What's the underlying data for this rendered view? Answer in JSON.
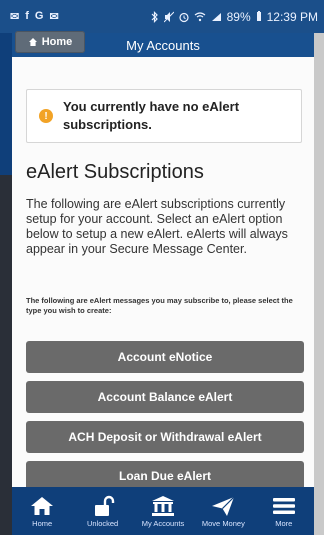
{
  "status_bar": {
    "left_icons": [
      "✉",
      "f",
      "G",
      "✉"
    ],
    "battery": "89%",
    "time": "12:39 PM"
  },
  "header": {
    "home_label": "Home",
    "title": "My Accounts"
  },
  "alert": {
    "text": "You currently have no eAlert subscriptions."
  },
  "section": {
    "title": "eAlert Subscriptions",
    "description": "The following are eAlert subscriptions currently setup for your account. Select an eAlert option below to setup a new eAlert. eAlerts will always appear in your Secure Message Center.",
    "note": "The following are eAlert messages you may subscribe to, please select the type you wish to create:"
  },
  "buttons": [
    {
      "label": "Account eNotice"
    },
    {
      "label": "Account Balance eAlert"
    },
    {
      "label": "ACH Deposit or Withdrawal eAlert"
    },
    {
      "label": "Loan Due eAlert"
    }
  ],
  "bottom_nav": [
    {
      "label": "Home",
      "icon": "home-icon"
    },
    {
      "label": "Unlocked",
      "icon": "unlock-icon"
    },
    {
      "label": "My Accounts",
      "icon": "bank-icon"
    },
    {
      "label": "Move Money",
      "icon": "send-icon"
    },
    {
      "label": "More",
      "icon": "menu-icon"
    }
  ],
  "colors": {
    "header": "#18508f",
    "nav": "#0f3f7a",
    "button": "#6a6a6a",
    "alert_icon": "#f2a326"
  }
}
